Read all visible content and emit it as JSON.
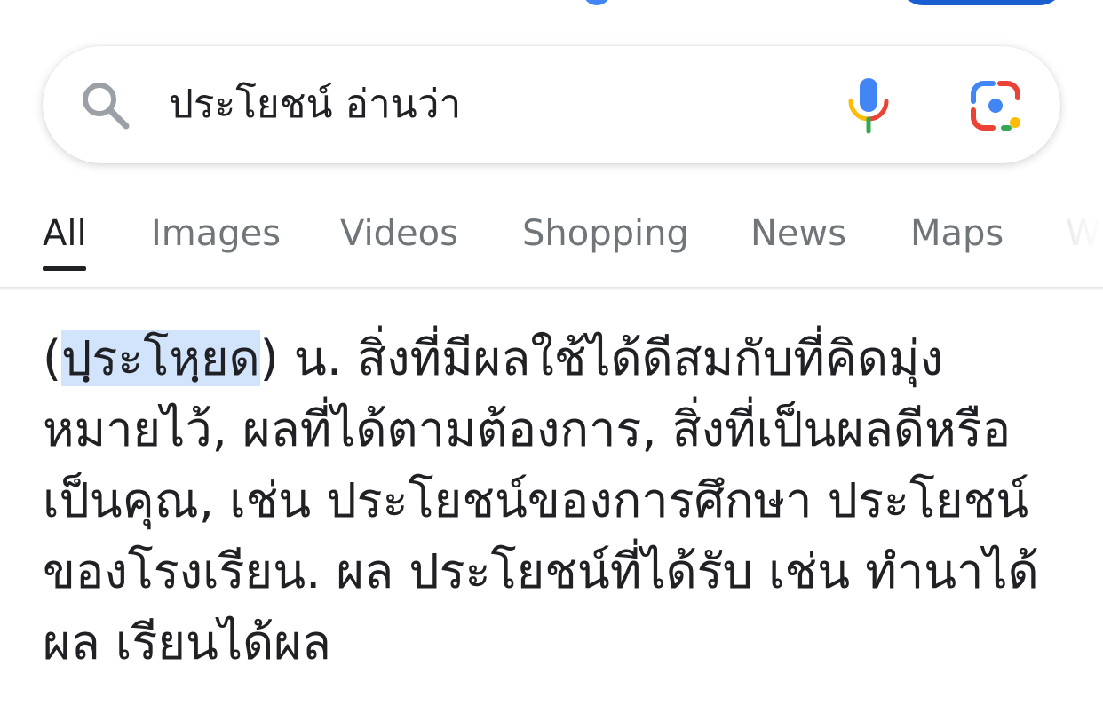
{
  "search": {
    "query": "ประโยชน์ อ่านว่า"
  },
  "tabs": [
    {
      "label": "All",
      "active": true
    },
    {
      "label": "Images",
      "active": false
    },
    {
      "label": "Videos",
      "active": false
    },
    {
      "label": "Shopping",
      "active": false
    },
    {
      "label": "News",
      "active": false
    },
    {
      "label": "Maps",
      "active": false
    },
    {
      "label": "W",
      "active": false
    }
  ],
  "result": {
    "open_paren": "(",
    "pronunciation": "ปฺระโหฺยด",
    "line1_rest": ") น. สิ่งที่มีผลใช้ได้ดีสมกับที่คิดมุ่ง",
    "line2": "หมายไว้, ผลที่ได้ตามต้องการ, สิ่งที่เป็นผลดีหรือ",
    "line3": "เป็นคุณ, เช่น ประโยชน์ของการศึกษา ประโยชน์",
    "line4": "ของโรงเรียน. ผล ประโยชน์ที่ได้รับ เช่น ทำนาได้",
    "line5": "ผล เรียนได้ผล"
  },
  "colors": {
    "highlight": "#d2e3fc",
    "text": "#202124",
    "tab_inactive": "#70757a",
    "google_blue": "#4285f4",
    "google_red": "#ea4335",
    "google_yellow": "#fbbc04",
    "google_green": "#34a853"
  }
}
